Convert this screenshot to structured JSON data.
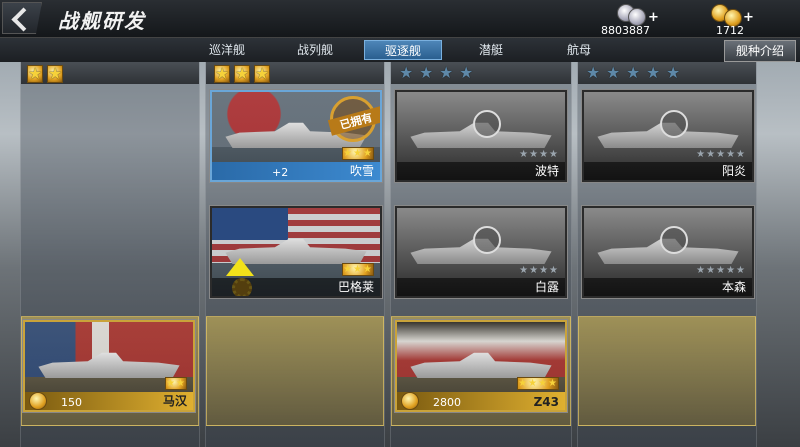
{
  "header": {
    "title": "战舰研发"
  },
  "resources": {
    "silver": "8803887",
    "gold": "1712",
    "plus": "+"
  },
  "tabs": [
    {
      "label": "巡洋舰"
    },
    {
      "label": "战列舰"
    },
    {
      "label": "驱逐舰"
    },
    {
      "label": "潜艇"
    },
    {
      "label": "航母"
    }
  ],
  "active_tab": "驱逐舰",
  "intro_button": "舰种介绍",
  "columns": [
    {
      "stars": 2,
      "ships": [
        {
          "name": "马汉",
          "stars": 2,
          "price": "150",
          "status": "purchasable"
        }
      ]
    },
    {
      "stars": 3,
      "ships": [
        {
          "name": "吹雪",
          "stars": 3,
          "level": "+2",
          "badge": "已拥有",
          "badge_ring": "ALREADY",
          "status": "owned"
        },
        {
          "name": "巴格莱",
          "stars": 3,
          "status": "upgradable"
        }
      ]
    },
    {
      "stars": 4,
      "ships": [
        {
          "name": "波特",
          "stars": 4,
          "status": "locked"
        },
        {
          "name": "白露",
          "stars": 4,
          "status": "locked"
        },
        {
          "name": "Z43",
          "stars": 4,
          "price": "2800",
          "status": "purchasable"
        }
      ]
    },
    {
      "stars": 5,
      "ships": [
        {
          "name": "阳炎",
          "stars": 5,
          "status": "locked"
        },
        {
          "name": "本森",
          "stars": 5,
          "status": "locked"
        }
      ]
    }
  ],
  "colors": {
    "star_gold": "#f6d23a",
    "star_blue": "#5e88a8",
    "owned_bar": "#3d8ad0",
    "tab_active": "#4e86b8"
  }
}
